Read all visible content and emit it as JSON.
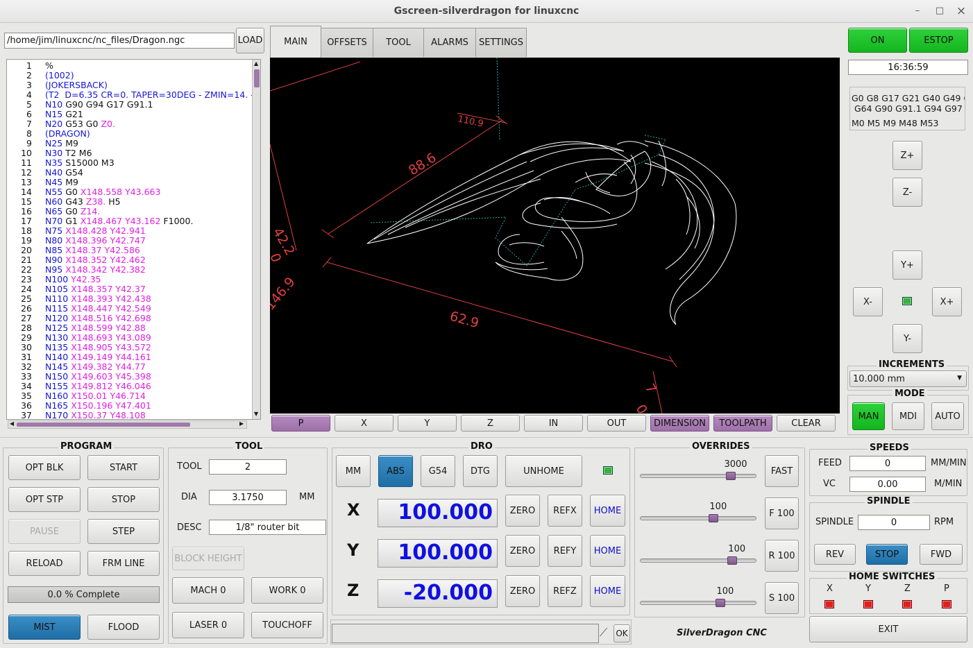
{
  "window": {
    "title": "Gscreen-silverdragon for linuxcnc",
    "min": "–",
    "max": "□",
    "close": "×"
  },
  "file": {
    "path": "/home/jim/linuxcnc/nc_files/Dragon.ngc",
    "load_label": "LOAD"
  },
  "gcode_lines": [
    {
      "n": "1",
      "parts": [
        [
          "%",
          "blk"
        ]
      ]
    },
    {
      "n": "2",
      "parts": [
        [
          "(1002)",
          "blue"
        ]
      ]
    },
    {
      "n": "3",
      "parts": [
        [
          "(JOKERSBACK)",
          "blue"
        ]
      ]
    },
    {
      "n": "4",
      "parts": [
        [
          "(T2  D=6.35 CR=0. TAPER=30DEG - ZMIN=14. -",
          "blue"
        ]
      ]
    },
    {
      "n": "5",
      "parts": [
        [
          "N10",
          "blue"
        ],
        [
          " G90 G94 G17 G91.1",
          "blk"
        ]
      ]
    },
    {
      "n": "6",
      "parts": [
        [
          "N15",
          "blue"
        ],
        [
          " G21",
          "blk"
        ]
      ]
    },
    {
      "n": "7",
      "parts": [
        [
          "N20",
          "blue"
        ],
        [
          " G53 G0 ",
          "blk"
        ],
        [
          "Z0.",
          "mag"
        ]
      ]
    },
    {
      "n": "8",
      "parts": [
        [
          "(DRAGON)",
          "blue"
        ]
      ]
    },
    {
      "n": "9",
      "parts": [
        [
          "N25",
          "blue"
        ],
        [
          " M9",
          "blk"
        ]
      ]
    },
    {
      "n": "10",
      "parts": [
        [
          "N30",
          "blue"
        ],
        [
          " T2 M6",
          "blk"
        ]
      ]
    },
    {
      "n": "11",
      "parts": [
        [
          "N35",
          "blue"
        ],
        [
          " S15000 M3",
          "blk"
        ]
      ]
    },
    {
      "n": "12",
      "parts": [
        [
          "N40",
          "blue"
        ],
        [
          " G54",
          "blk"
        ]
      ]
    },
    {
      "n": "13",
      "parts": [
        [
          "N45",
          "blue"
        ],
        [
          " M9",
          "blk"
        ]
      ]
    },
    {
      "n": "14",
      "parts": [
        [
          "N55",
          "blue"
        ],
        [
          " G0 ",
          "blk"
        ],
        [
          "X148.558 Y43.663",
          "mag"
        ]
      ]
    },
    {
      "n": "15",
      "parts": [
        [
          "N60",
          "blue"
        ],
        [
          " G43 ",
          "blk"
        ],
        [
          "Z38.",
          "mag"
        ],
        [
          " H5",
          "blk"
        ]
      ]
    },
    {
      "n": "16",
      "parts": [
        [
          "N65",
          "blue"
        ],
        [
          " G0 ",
          "blk"
        ],
        [
          "Z14.",
          "mag"
        ]
      ]
    },
    {
      "n": "17",
      "parts": [
        [
          "N70",
          "blue"
        ],
        [
          " G1 ",
          "blk"
        ],
        [
          "X148.467 Y43.162",
          "mag"
        ],
        [
          " F1000.",
          "blk"
        ]
      ]
    },
    {
      "n": "18",
      "parts": [
        [
          "N75",
          "blue"
        ],
        [
          " X148.428 Y42.941",
          "mag"
        ]
      ]
    },
    {
      "n": "19",
      "parts": [
        [
          "N80",
          "blue"
        ],
        [
          " X148.396 Y42.747",
          "mag"
        ]
      ]
    },
    {
      "n": "20",
      "parts": [
        [
          "N85",
          "blue"
        ],
        [
          " X148.37 Y42.586",
          "mag"
        ]
      ]
    },
    {
      "n": "21",
      "parts": [
        [
          "N90",
          "blue"
        ],
        [
          " X148.352 Y42.462",
          "mag"
        ]
      ]
    },
    {
      "n": "22",
      "parts": [
        [
          "N95",
          "blue"
        ],
        [
          " X148.342 Y42.382",
          "mag"
        ]
      ]
    },
    {
      "n": "23",
      "parts": [
        [
          "N100",
          "blue"
        ],
        [
          " Y42.35",
          "mag"
        ]
      ]
    },
    {
      "n": "24",
      "parts": [
        [
          "N105",
          "blue"
        ],
        [
          " X148.357 Y42.37",
          "mag"
        ]
      ]
    },
    {
      "n": "25",
      "parts": [
        [
          "N110",
          "blue"
        ],
        [
          " X148.393 Y42.438",
          "mag"
        ]
      ]
    },
    {
      "n": "26",
      "parts": [
        [
          "N115",
          "blue"
        ],
        [
          " X148.447 Y42.549",
          "mag"
        ]
      ]
    },
    {
      "n": "27",
      "parts": [
        [
          "N120",
          "blue"
        ],
        [
          " X148.516 Y42.698",
          "mag"
        ]
      ]
    },
    {
      "n": "28",
      "parts": [
        [
          "N125",
          "blue"
        ],
        [
          " X148.599 Y42.88",
          "mag"
        ]
      ]
    },
    {
      "n": "29",
      "parts": [
        [
          "N130",
          "blue"
        ],
        [
          " X148.693 Y43.089",
          "mag"
        ]
      ]
    },
    {
      "n": "30",
      "parts": [
        [
          "N135",
          "blue"
        ],
        [
          " X148.905 Y43.572",
          "mag"
        ]
      ]
    },
    {
      "n": "31",
      "parts": [
        [
          "N140",
          "blue"
        ],
        [
          " X149.149 Y44.161",
          "mag"
        ]
      ]
    },
    {
      "n": "32",
      "parts": [
        [
          "N145",
          "blue"
        ],
        [
          " X149.382 Y44.77",
          "mag"
        ]
      ]
    },
    {
      "n": "33",
      "parts": [
        [
          "N150",
          "blue"
        ],
        [
          " X149.603 Y45.398",
          "mag"
        ]
      ]
    },
    {
      "n": "34",
      "parts": [
        [
          "N155",
          "blue"
        ],
        [
          " X149.812 Y46.046",
          "mag"
        ]
      ]
    },
    {
      "n": "35",
      "parts": [
        [
          "N160",
          "blue"
        ],
        [
          " X150.01 Y46.714",
          "mag"
        ]
      ]
    },
    {
      "n": "36",
      "parts": [
        [
          "N165",
          "blue"
        ],
        [
          " X150.196 Y47.401",
          "mag"
        ]
      ]
    },
    {
      "n": "37",
      "parts": [
        [
          "N170",
          "blue"
        ],
        [
          " X150.37 Y48.108",
          "mag"
        ]
      ]
    }
  ],
  "tabs": [
    {
      "label": "MAIN",
      "active": true
    },
    {
      "label": "OFFSETS",
      "active": false
    },
    {
      "label": "TOOL",
      "active": false
    },
    {
      "label": "ALARMS",
      "active": false
    },
    {
      "label": "SETTINGS",
      "active": false
    }
  ],
  "preview": {
    "dim_labels": [
      "110.9",
      "88.6",
      "42.2",
      "0",
      "146.9",
      "62.9",
      "7",
      "0."
    ],
    "colors": {
      "dimension": "#e04040",
      "toolpath": "#ffffff",
      "rapid": "#2aa8a8"
    }
  },
  "view_buttons": [
    "P",
    "X",
    "Y",
    "Z",
    "IN",
    "OUT",
    "DIMENSION",
    "TOOLPATH",
    "CLEAR"
  ],
  "machine": {
    "on_label": "ON",
    "estop_label": "ESTOP",
    "clock": "16:36:59"
  },
  "gcodes_active": {
    "line1": "G0 G8 G17 G21 G40 G49 G",
    "line2": "G64 G90 G91.1 G94 G97 G",
    "line3": "M0 M5 M9 M48 M53"
  },
  "jog": {
    "zplus": "Z+",
    "zminus": "Z-",
    "yplus": "Y+",
    "yminus": "Y-",
    "xminus": "X-",
    "xplus": "X+"
  },
  "increments": {
    "title": "INCREMENTS",
    "value": "10.000 mm"
  },
  "mode": {
    "title": "MODE",
    "man": "MAN",
    "mdi": "MDI",
    "auto": "AUTO"
  },
  "program": {
    "title": "PROGRAM",
    "opt_blk": "OPT BLK",
    "start": "START",
    "opt_stp": "OPT STP",
    "stop": "STOP",
    "pause": "PAUSE",
    "step": "STEP",
    "reload": "RELOAD",
    "frm_line": "FRM LINE",
    "progress": 0.0,
    "progress_text": "0.0 % Complete",
    "mist": "MIST",
    "flood": "FLOOD"
  },
  "tool": {
    "title": "TOOL",
    "tool_label": "TOOL",
    "tool_value": "2",
    "dia_label": "DIA",
    "dia_value": "3.1750",
    "dia_unit": "MM",
    "desc_label": "DESC",
    "desc_value": "1/8\" router bit",
    "block_height": "BLOCK HEIGHT",
    "mach0": "MACH 0",
    "work0": "WORK 0",
    "laser0": "LASER 0",
    "touchoff": "TOUCHOFF"
  },
  "dro": {
    "title": "DRO",
    "mm": "MM",
    "abs": "ABS",
    "g54": "G54",
    "dtg": "DTG",
    "unhome": "UNHOME",
    "axes": [
      {
        "axis": "X",
        "value": "100.000",
        "zero": "ZERO",
        "ref": "REFX",
        "home": "HOME"
      },
      {
        "axis": "Y",
        "value": "100.000",
        "zero": "ZERO",
        "ref": "REFY",
        "home": "HOME"
      },
      {
        "axis": "Z",
        "value": "-20.000",
        "zero": "ZERO",
        "ref": "REFZ",
        "home": "HOME"
      }
    ]
  },
  "mdi": {
    "value": "",
    "ok": "OK"
  },
  "brand": "SilverDragon CNC",
  "overrides": {
    "title": "OVERRIDES",
    "rows": [
      {
        "value": "3000",
        "fraction": 0.78,
        "button": "FAST"
      },
      {
        "value": "100",
        "fraction": 0.63,
        "button": "F 100"
      },
      {
        "value": "100",
        "fraction": 0.79,
        "button": "R 100"
      },
      {
        "value": "100",
        "fraction": 0.69,
        "button": "S 100"
      }
    ]
  },
  "speeds": {
    "title": "SPEEDS",
    "feed_label": "FEED",
    "feed_value": "0",
    "feed_unit": "MM/MIN",
    "vc_label": "VC",
    "vc_value": "0.00",
    "vc_unit": "M/MIN"
  },
  "spindle": {
    "title": "SPINDLE",
    "label": "SPINDLE",
    "value": "0",
    "unit": "RPM",
    "rev": "REV",
    "stop": "STOP",
    "fwd": "FWD"
  },
  "home_switches": {
    "title": "HOME SWITCHES",
    "labels": [
      "X",
      "Y",
      "Z",
      "P"
    ]
  },
  "exit_label": "EXIT"
}
